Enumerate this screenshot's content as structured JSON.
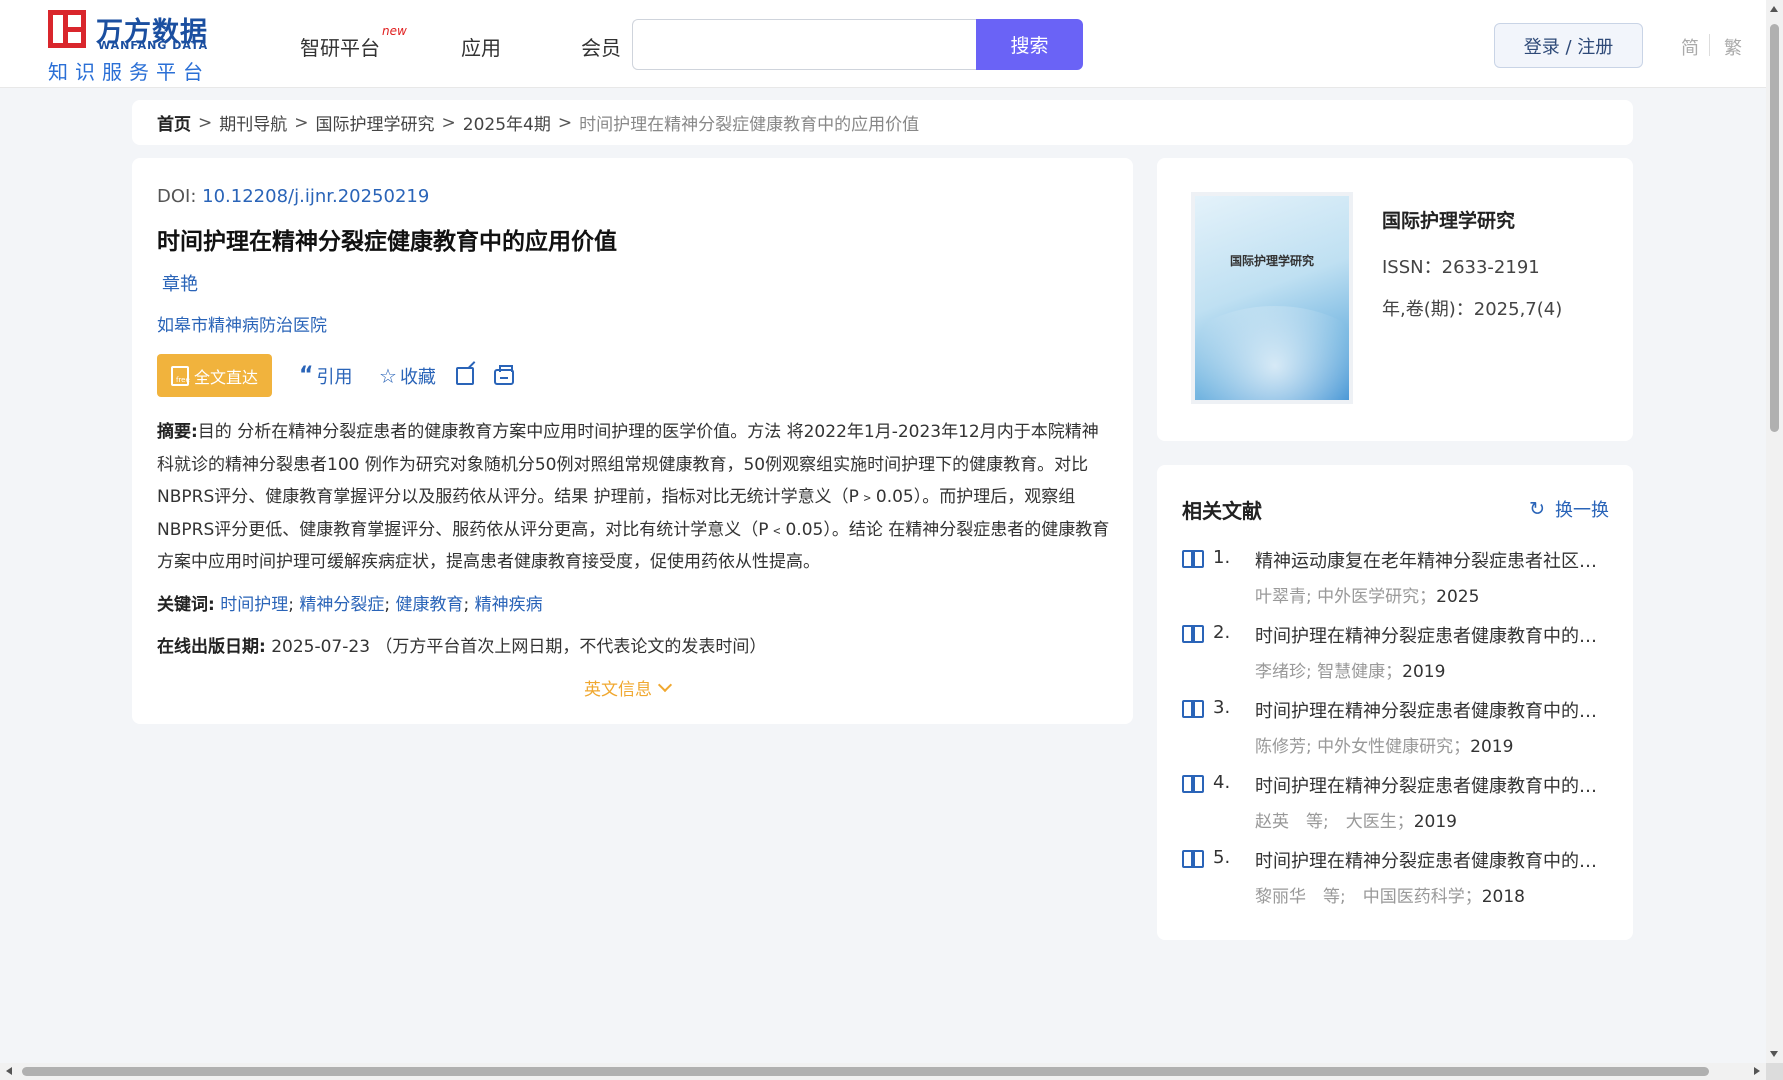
{
  "header": {
    "logo": {
      "cn": "万方数据",
      "en": "WANFANG DATA",
      "sub": "知识服务平台"
    },
    "nav": [
      {
        "label": "智研平台",
        "badge": "new"
      },
      {
        "label": "应用"
      },
      {
        "label": "会员"
      }
    ],
    "search": {
      "value": "",
      "button": "搜索"
    },
    "login": "登录 / 注册",
    "lang_simplified": "简",
    "lang_traditional": "繁"
  },
  "breadcrumb": {
    "home": "首页",
    "items": [
      "期刊导航",
      "国际护理学研究",
      "2025年4期"
    ],
    "current": "时间护理在精神分裂症健康教育中的应用价值",
    "separator": ">"
  },
  "article": {
    "doi_label": "DOI:",
    "doi": "10.12208/j.ijnr.20250219",
    "title": "时间护理在精神分裂症健康教育中的应用价值",
    "author": "章艳",
    "organization": "如皋市精神病防治医院",
    "actions": {
      "fulltext": "全文直达",
      "cite": "引用",
      "favorite": "收藏"
    },
    "abstract_label": "摘要:",
    "abstract": "目的 分析在精神分裂症患者的健康教育方案中应用时间护理的医学价值。方法 将2022年1月-2023年12月内于本院精神科就诊的精神分裂患者100 例作为研究对象随机分50例对照组常规健康教育，50例观察组实施时间护理下的健康教育。对比NBPRS评分、健康教育掌握评分以及服药依从评分。结果 护理前，指标对比无统计学意义（P﹥0.05）。而护理后，观察组NBPRS评分更低、健康教育掌握评分、服药依从评分更高，对比有统计学意义（P﹤0.05）。结论 在精神分裂症患者的健康教育方案中应用时间护理可缓解疾病症状，提高患者健康教育接受度，促使用药依从性提高。",
    "keywords_label": "关键词:",
    "keywords": [
      "时间护理",
      "精神分裂症",
      "健康教育",
      "精神疾病"
    ],
    "pubdate_label": "在线出版日期:",
    "pubdate": "2025-07-23",
    "pubdate_note": "（万方平台首次上网日期，不代表论文的发表时间）",
    "english_info": "英文信息"
  },
  "journal": {
    "cover_title": "国际护理学研究",
    "name": "国际护理学研究",
    "issn": "ISSN：2633-2191",
    "volume": "年,卷(期)：2025,7(4)"
  },
  "related": {
    "heading": "相关文献",
    "refresh": "换一换",
    "items": [
      {
        "num": "1.",
        "title": "精神运动康复在老年精神分裂症患者社区管理中的应用",
        "meta": "叶翠青; 中外医学研究；",
        "year": "2025"
      },
      {
        "num": "2.",
        "title": "时间护理在精神分裂症患者健康教育中的应用效果分析",
        "meta": "李绪珍; 智慧健康；",
        "year": "2019"
      },
      {
        "num": "3.",
        "title": "时间护理在精神分裂症患者健康教育中的应用",
        "meta": "陈修芳; 中外女性健康研究；",
        "year": "2019"
      },
      {
        "num": "4.",
        "title": "时间护理在精神分裂症患者健康教育中的应用",
        "meta": "赵英　等;　大医生；",
        "year": "2019"
      },
      {
        "num": "5.",
        "title": "时间护理在精神分裂症患者健康教育中的应用",
        "meta": "黎丽华　等;　中国医药科学；",
        "year": "2018"
      }
    ]
  }
}
